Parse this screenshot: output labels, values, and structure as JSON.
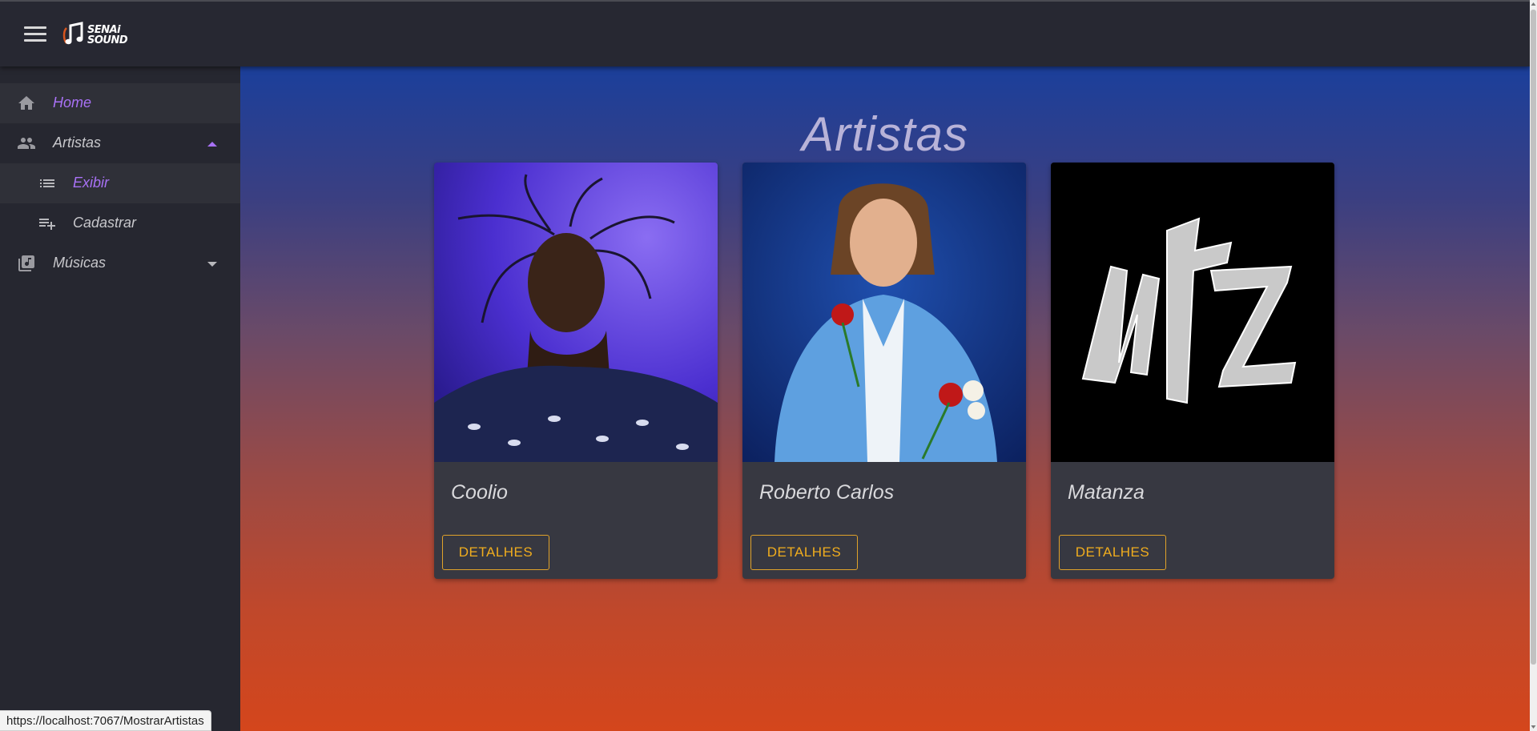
{
  "app": {
    "logo_line1": "SENAi",
    "logo_line2": "SOUND"
  },
  "sidebar": {
    "items": [
      {
        "label": "Home",
        "icon": "home-icon"
      },
      {
        "label": "Artistas",
        "icon": "people-icon"
      },
      {
        "label": "Exibir",
        "icon": "list-icon"
      },
      {
        "label": "Cadastrar",
        "icon": "playlist-add-icon"
      },
      {
        "label": "Músicas",
        "icon": "library-music-icon"
      }
    ]
  },
  "page": {
    "title": "Artistas"
  },
  "artists": [
    {
      "name": "Coolio",
      "button": "DETALHES"
    },
    {
      "name": "Roberto Carlos",
      "button": "DETALHES"
    },
    {
      "name": "Matanza",
      "button": "DETALHES"
    }
  ],
  "status_url": "https://localhost:7067/MostrarArtistas",
  "colors": {
    "accent_purple": "#a871f5",
    "button_orange": "#f0ad1e",
    "gradient_top": "#1b3f9b",
    "gradient_bottom": "#d4461c"
  }
}
